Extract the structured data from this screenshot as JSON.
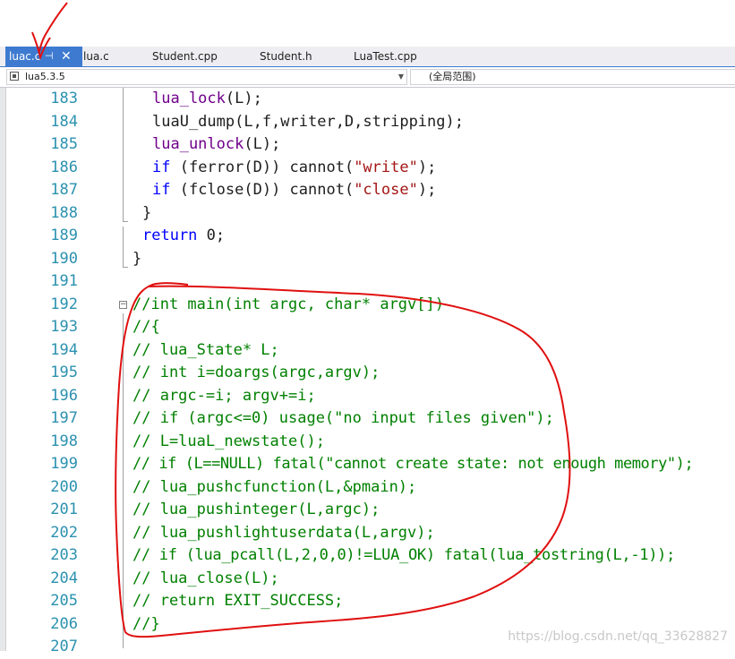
{
  "tabs": [
    {
      "label": "luac.c",
      "active": true
    },
    {
      "label": "lua.c",
      "active": false
    },
    {
      "label": "Student.cpp",
      "active": false
    },
    {
      "label": "Student.h",
      "active": false
    },
    {
      "label": "LuaTest.cpp",
      "active": false
    }
  ],
  "tab_icons": {
    "pin": "⊣",
    "close": "✕"
  },
  "navbar": {
    "project": "lua5.3.5",
    "scope": "(全局范围)"
  },
  "line_numbers": [
    "183",
    "184",
    "185",
    "186",
    "187",
    "188",
    "189",
    "190",
    "191",
    "192",
    "193",
    "194",
    "195",
    "196",
    "197",
    "198",
    "199",
    "200",
    "201",
    "202",
    "203",
    "204",
    "205",
    "206",
    "207"
  ],
  "code": {
    "l183": [
      "lua_lock",
      "(L);"
    ],
    "l184": "luaU_dump(L,f,writer,D,stripping);",
    "l185": [
      "lua_unlock",
      "(L);"
    ],
    "l186": [
      "if",
      " (ferror(D)) cannot(",
      "\"write\"",
      ");"
    ],
    "l187": [
      "if",
      " (fclose(D)) cannot(",
      "\"close\"",
      ");"
    ],
    "l188": "}",
    "l189": [
      "return",
      " 0;"
    ],
    "l190": "}",
    "l192": "//int main(int argc, char* argv[])",
    "l193": "//{",
    "l194": "// lua_State* L;",
    "l195": "// int i=doargs(argc,argv);",
    "l196": "// argc-=i; argv+=i;",
    "l197": "// if (argc<=0) usage(\"no input files given\");",
    "l198": "// L=luaL_newstate();",
    "l199": "// if (L==NULL) fatal(\"cannot create state: not enough memory\");",
    "l200": "// lua_pushcfunction(L,&pmain);",
    "l201": "// lua_pushinteger(L,argc);",
    "l202": "// lua_pushlightuserdata(L,argv);",
    "l203": "// if (lua_pcall(L,2,0,0)!=LUA_OK) fatal(lua_tostring(L,-1));",
    "l204": "// lua_close(L);",
    "l205": "// return EXIT_SUCCESS;",
    "l206": "//}"
  },
  "fold_icon": "−",
  "watermark": "https://blog.csdn.net/qq_33628827",
  "colors": {
    "keyword": "#0000ff",
    "function": "#6f008a",
    "string": "#a31515",
    "comment": "#008000",
    "line_number": "#2b91af",
    "active_tab": "#3e7bd0",
    "annotation": "#e01010"
  }
}
